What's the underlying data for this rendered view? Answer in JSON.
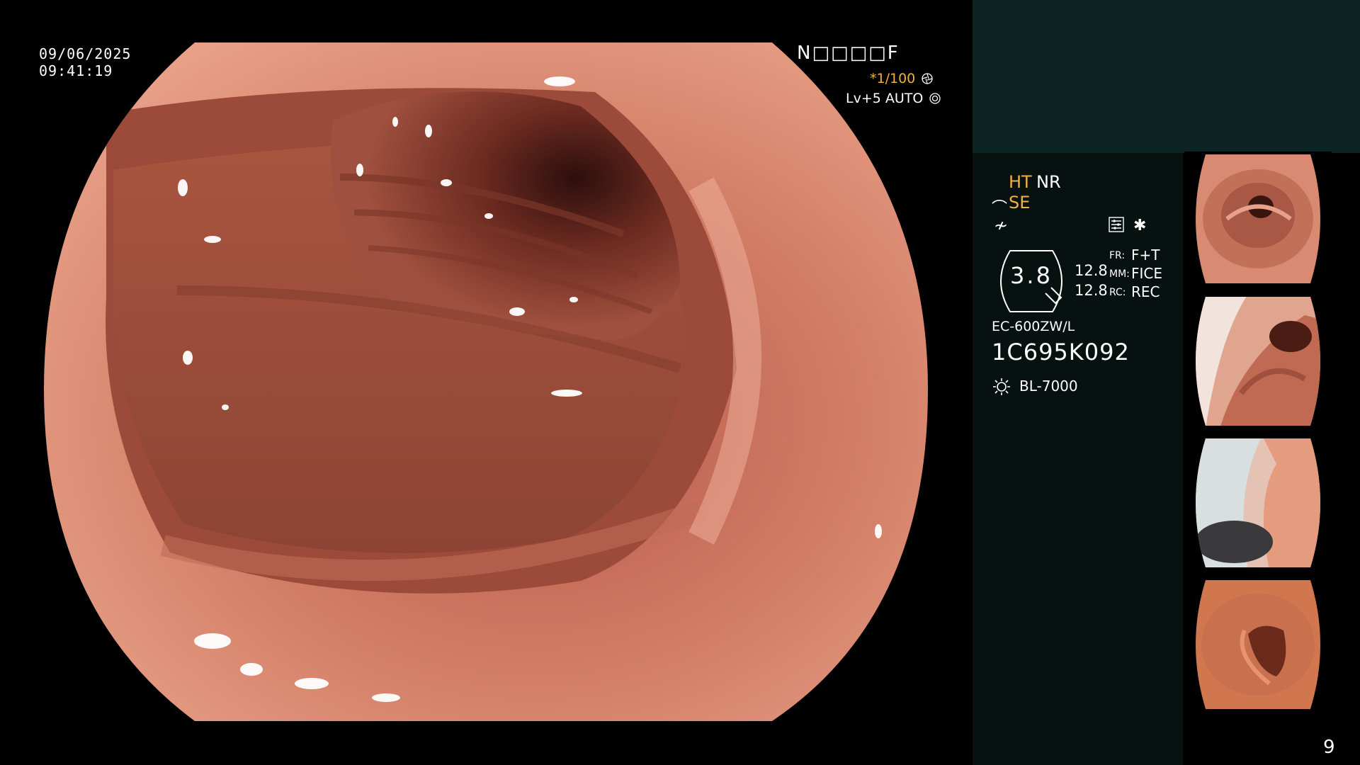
{
  "overlay": {
    "date": "09/06/2025",
    "time": "09:41:19",
    "patient_id": "N□□□□F",
    "shutter_prefix": "*1/100",
    "iris": "Lv+5 AUTO"
  },
  "side_panel": {
    "ht_label": "HT",
    "nr_label": "NR",
    "se_label": "SE",
    "zoom_value": "3.8",
    "param_values": [
      "12.8",
      "12.8"
    ],
    "params": [
      {
        "key": "FR:",
        "value": "F+T"
      },
      {
        "key": "MM:",
        "value": "FICE"
      },
      {
        "key": "RC:",
        "value": "REC"
      }
    ],
    "scope_model": "EC-600ZW/L",
    "scope_serial": "1C695K092",
    "light_source": "BL-7000"
  },
  "page_number": "9",
  "colors": {
    "accent_orange": "#f0b23c",
    "side_top": "#0d2424",
    "side_panel": "#07110f",
    "mucosa": "#c8705a"
  },
  "icons": [
    "camera-aperture-icon",
    "iris-icon",
    "scope-tip-icon",
    "edge-filter-icon",
    "structure-icon",
    "light-source-icon"
  ]
}
